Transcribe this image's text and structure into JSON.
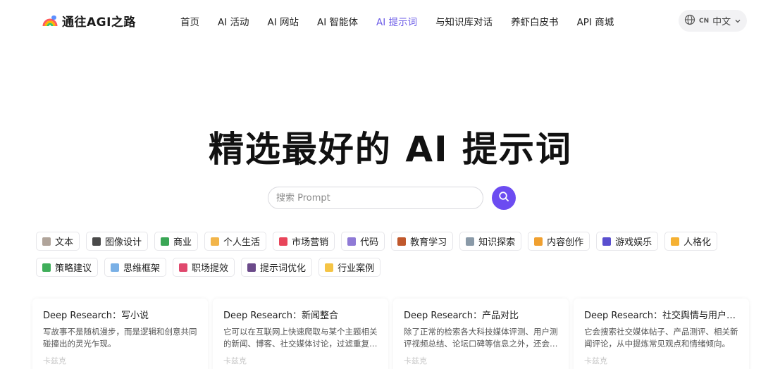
{
  "brand": {
    "name": "通往AGI之路",
    "colors": [
      "#ff5a5a",
      "#ffb400",
      "#36c26a",
      "#3f7bff"
    ]
  },
  "nav": {
    "items": [
      {
        "label": "首页",
        "active": false
      },
      {
        "label": "AI 活动",
        "active": false
      },
      {
        "label": "AI 网站",
        "active": false
      },
      {
        "label": "AI 智能体",
        "active": false
      },
      {
        "label": "AI 提示词",
        "active": true
      },
      {
        "label": "与知识库对话",
        "active": false
      },
      {
        "label": "养虾白皮书",
        "active": false
      },
      {
        "label": "API 商城",
        "active": false
      }
    ],
    "active_color": "#6c5ce7"
  },
  "lang": {
    "code": "CN",
    "label": "中文",
    "icon": "globe-icon"
  },
  "hero": {
    "title": "精选最好的 AI 提示词"
  },
  "search": {
    "placeholder": "搜索 Prompt",
    "button_icon": "search-icon",
    "button_color": "#6c4cf1"
  },
  "tags": [
    {
      "label": "文本",
      "icon": "memo-icon",
      "color": "#b0a49a"
    },
    {
      "label": "图像设计",
      "icon": "framed-picture-icon",
      "color": "#4a4a4a"
    },
    {
      "label": "商业",
      "icon": "money-icon",
      "color": "#3aa655"
    },
    {
      "label": "个人生活",
      "icon": "person-icon",
      "color": "#f2b54a"
    },
    {
      "label": "市场营销",
      "icon": "megaphone-icon",
      "color": "#e8455a"
    },
    {
      "label": "代码",
      "icon": "technologist-icon",
      "color": "#8f7ad6"
    },
    {
      "label": "教育学习",
      "icon": "books-icon",
      "color": "#c0582c"
    },
    {
      "label": "知识探索",
      "icon": "microscope-icon",
      "color": "#8a9aa8"
    },
    {
      "label": "内容创作",
      "icon": "writing-hand-icon",
      "color": "#f0a030"
    },
    {
      "label": "游戏娱乐",
      "icon": "game-controller-icon",
      "color": "#5a4fcf"
    },
    {
      "label": "人格化",
      "icon": "face-icon",
      "color": "#f5b133"
    },
    {
      "label": "策略建议",
      "icon": "flag-in-hole-icon",
      "color": "#3fae5a"
    },
    {
      "label": "思维框架",
      "icon": "book-icon",
      "color": "#7ab0e6"
    },
    {
      "label": "职场提效",
      "icon": "briefcase-icon",
      "color": "#e0486d"
    },
    {
      "label": "提示词优化",
      "icon": "crystal-ball-icon",
      "color": "#6b4a8a"
    },
    {
      "label": "行业案例",
      "icon": "folder-icon",
      "color": "#f5c445"
    }
  ],
  "cards": [
    {
      "title": "Deep Research：写小说",
      "desc": "写故事不是随机漫步，而是逻辑和创意共同碰撞出的灵光乍现。",
      "author": "卡兹克"
    },
    {
      "title": "Deep Research：新闻整合",
      "desc": "它可以在互联网上快速爬取与某个主题相关的新闻、博客、社交媒体讨论，过滤重复…",
      "author": "卡兹克"
    },
    {
      "title": "Deep Research：产品对比",
      "desc": "除了正常的检索各大科技媒体评测、用户测评视频总结、论坛口碑等信息之外，还会…",
      "author": "卡兹克"
    },
    {
      "title": "Deep Research：社交舆情与用户情…",
      "desc": "它会搜索社交媒体帖子、产品测评、相关新闻评论，从中提炼常见观点和情绪倾向。",
      "author": "卡兹克"
    }
  ]
}
